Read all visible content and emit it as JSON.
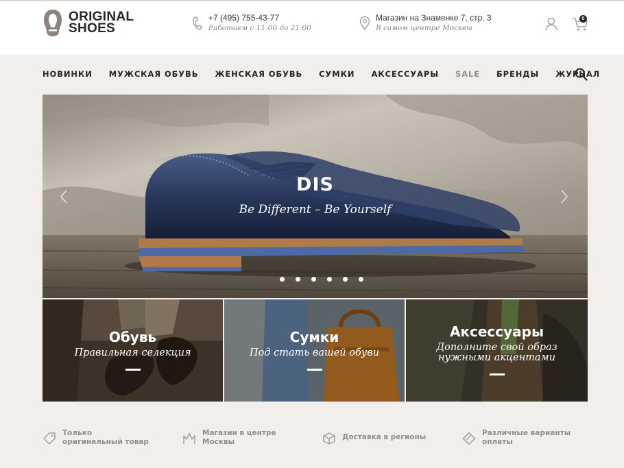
{
  "brand": {
    "line1": "ORIGINAL",
    "line2": "SHOES"
  },
  "contacts": {
    "phone": "+7 (495) 755-43-77",
    "hours": "Работаем с 11:00 до 21:00",
    "address": "Магазин на Знаменке 7, стр. 3",
    "address_note": "В самом центре Москвы"
  },
  "cart": {
    "count": "0"
  },
  "icons": {
    "phone": "phone-icon",
    "location": "map-pin-icon",
    "user": "user-icon",
    "cart": "cart-icon",
    "search": "search-icon",
    "prev": "chevron-left-icon",
    "next": "chevron-right-icon"
  },
  "menu": [
    {
      "label": "НОВИНКИ"
    },
    {
      "label": "МУЖСКАЯ ОБУВЬ"
    },
    {
      "label": "ЖЕНСКАЯ ОБУВЬ"
    },
    {
      "label": "СУМКИ"
    },
    {
      "label": "АКСЕССУАРЫ"
    },
    {
      "label": "SALE"
    },
    {
      "label": "БРЕНДЫ"
    },
    {
      "label": "ЖУРНАЛ"
    }
  ],
  "hero": {
    "title": "DIS",
    "subtitle": "Be Different – Be Yourself",
    "slide_count": 6
  },
  "tiles": [
    {
      "title": "Обувь",
      "subtitle": "Правильная селекция"
    },
    {
      "title": "Сумки",
      "subtitle": "Под стать вашей обуви"
    },
    {
      "title": "Аксессуары",
      "subtitle_line1": "Дополните свой образ",
      "subtitle_line2": "нужными акцентами"
    }
  ],
  "features": [
    {
      "line1": "Только",
      "line2": "оригинальный товар",
      "icon": "tag-icon"
    },
    {
      "line1": "Магазин в центре",
      "line2": "Москвы",
      "icon": "crown-icon"
    },
    {
      "line1": "Доставка в регионы",
      "line2": "",
      "icon": "box-icon"
    },
    {
      "line1": "Различные варианты",
      "line2": "оплаты",
      "icon": "card-icon"
    }
  ],
  "colors": {
    "accent": "#2a2522",
    "muted": "#948c86",
    "sale": "#9a8f88",
    "background": "#f1eeeb"
  }
}
